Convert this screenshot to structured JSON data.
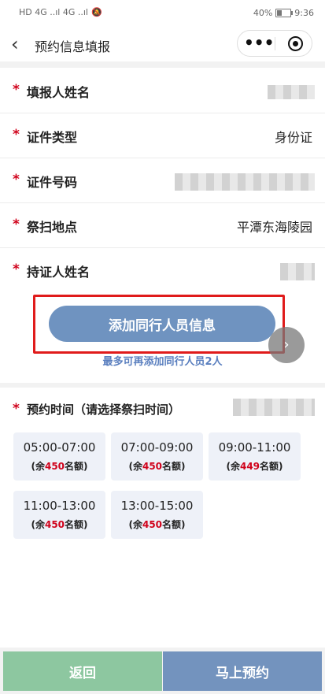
{
  "status": {
    "signal_left": "HD 4G ..ıl 4G ..ıl",
    "mute_icon": "bell-off-icon",
    "battery_text": "40%",
    "time": "9:36"
  },
  "nav": {
    "back_icon": "chevron-left",
    "title": "预约信息填报",
    "more_icon": "•••",
    "target_icon": "record-target-icon"
  },
  "form": {
    "required_mark": "*",
    "rows": [
      {
        "label": "填报人姓名",
        "value": ""
      },
      {
        "label": "证件类型",
        "value": "身份证"
      },
      {
        "label": "证件号码",
        "value": ""
      },
      {
        "label": "祭扫地点",
        "value": "平潭东海陵园"
      },
      {
        "label": "持证人姓名",
        "value": ""
      }
    ]
  },
  "companion": {
    "add_button_label": "添加同行人员信息",
    "hint": "最多可再添加同行人员2人",
    "next_icon": "›"
  },
  "booking": {
    "title": "预约时间（请选择祭扫时间）",
    "slots": [
      {
        "time": "05:00-07:00",
        "prefix": "(余",
        "remaining": "450",
        "suffix": "名额)"
      },
      {
        "time": "07:00-09:00",
        "prefix": "(余",
        "remaining": "450",
        "suffix": "名额)"
      },
      {
        "time": "09:00-11:00",
        "prefix": "(余",
        "remaining": "449",
        "suffix": "名额)"
      },
      {
        "time": "11:00-13:00",
        "prefix": "(余",
        "remaining": "450",
        "suffix": "名额)"
      },
      {
        "time": "13:00-15:00",
        "prefix": "(余",
        "remaining": "450",
        "suffix": "名额)"
      }
    ]
  },
  "footer": {
    "back_label": "返回",
    "book_label": "马上预约"
  },
  "colors": {
    "required": "#d0021b",
    "primary_blue": "#6f93c0",
    "back_green": "#8dc7a0",
    "highlight_box": "#e01b1b"
  }
}
